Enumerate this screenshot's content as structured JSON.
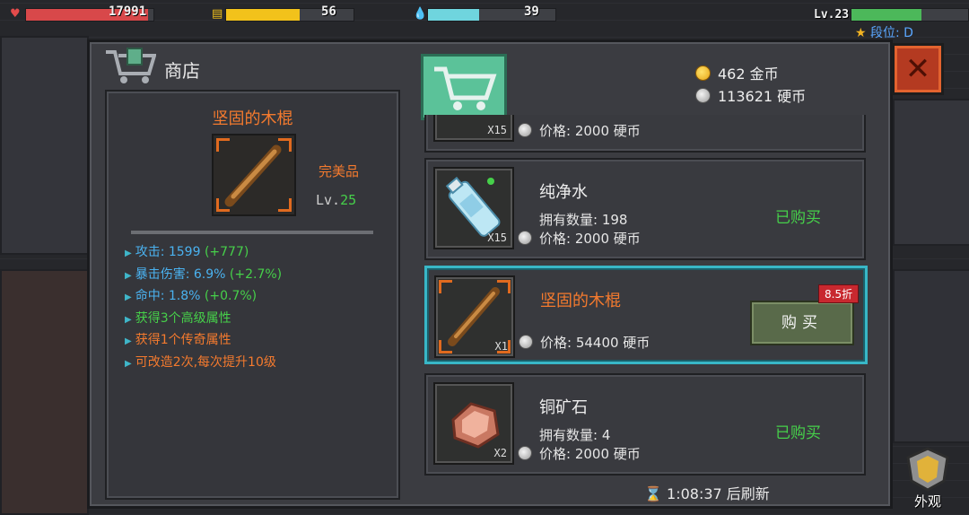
{
  "hud": {
    "hp_value": "17991",
    "hp_fill": 0.96,
    "hunger_value": "56",
    "hunger_fill": 0.58,
    "water_value": "39",
    "water_fill": 0.4,
    "level_label": "Lv.23",
    "level_fill": 0.6,
    "rank_label": "段位: D",
    "colors": {
      "hp": "#d8484a",
      "hunger": "#f2c21b",
      "water": "#6fd5de",
      "xp": "#4cb85a"
    }
  },
  "shop": {
    "title": "商店",
    "gold_amount": "462 金币",
    "coin_amount": "113621 硬币",
    "refresh_text": "1:08:37 后刷新",
    "close_icon": "close-x-icon",
    "appearance_label": "外观"
  },
  "detail": {
    "name": "坚固的木棍",
    "quality": "完美品",
    "level_prefix": "Lv.",
    "level_num": "25",
    "stats": [
      {
        "label": "攻击: 1599",
        "bonus": "(+777)"
      },
      {
        "label": "暴击伤害: 6.9%",
        "bonus": "(+2.7%)"
      },
      {
        "label": "命中: 1.8%",
        "bonus": "(+0.7%)"
      }
    ],
    "traits": [
      "获得3个高级属性",
      "获得1个传奇属性",
      "可改造2次,每次提升10级"
    ]
  },
  "items": [
    {
      "name": "",
      "qty": "X15",
      "owned": "",
      "price": "价格: 2000 硬币",
      "status": ""
    },
    {
      "name": "纯净水",
      "qty": "X15",
      "owned": "拥有数量: 198",
      "price": "价格: 2000 硬币",
      "status": "已购买"
    },
    {
      "name": "坚固的木棍",
      "qty": "X1",
      "owned": "",
      "price": "价格: 54400 硬币",
      "status": "",
      "discount": "8.5折",
      "buy_label": "购买"
    },
    {
      "name": "铜矿石",
      "qty": "X2",
      "owned": "拥有数量: 4",
      "price": "价格: 2000 硬币",
      "status": "已购买"
    }
  ]
}
